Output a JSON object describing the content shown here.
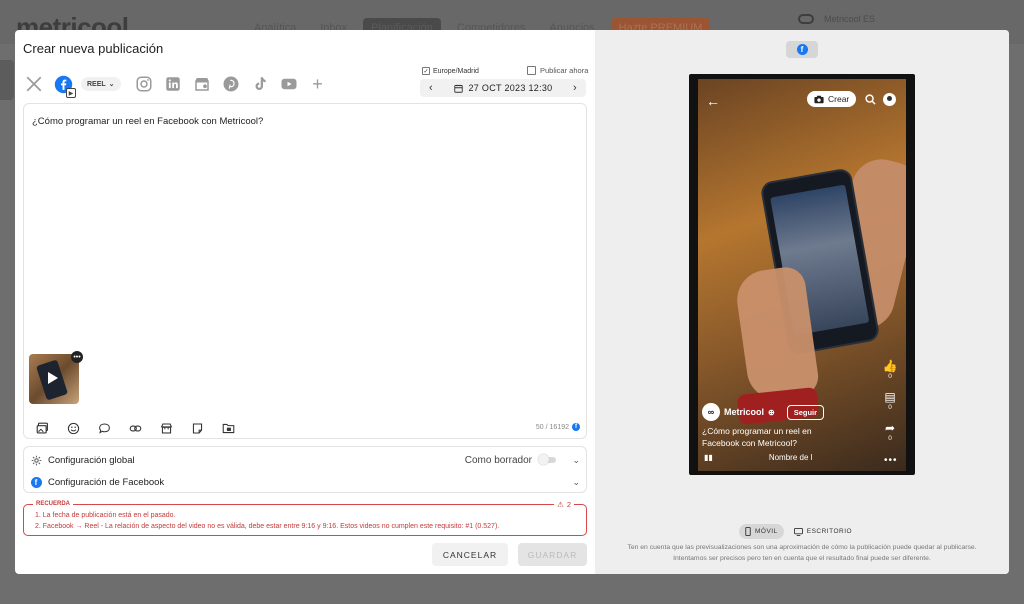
{
  "background": {
    "logo": "metricool",
    "nav": [
      "Analítica",
      "Inbox",
      "Planificación",
      "Competidores",
      "Anuncios"
    ],
    "nav_active": "Planificación",
    "premium": "Hazte PREMIUM",
    "account": "Metricool ES"
  },
  "modal": {
    "title": "Crear nueva publicación",
    "networks": [
      "twitter-x",
      "facebook",
      "instagram",
      "linkedin",
      "google-business",
      "pinterest",
      "tiktok",
      "youtube"
    ],
    "reel_select": "REEL",
    "timezone": "Europe/Madrid",
    "publish_now": "Publicar ahora",
    "date": "27 OCT 2023 12:30",
    "editor_text": "¿Cómo programar un reel en Facebook con Metricool?",
    "counter": "50 / 16192",
    "config_global": "Configuración global",
    "draft_label": "Como borrador",
    "config_facebook": "Configuración de Facebook",
    "warning_title": "RECUERDA",
    "warning_count": "2",
    "warnings": [
      "1. La fecha de publicación está en el pasado.",
      "2. Facebook → Reel - La relación de aspecto del video no es válida, debe estar entre 9:16 y 9:16. Estos videos no cumplen este requisito: #1 (0.527)."
    ],
    "cancel_label": "CANCELAR",
    "save_label": "GUARDAR"
  },
  "preview": {
    "crear_label": "Crear",
    "likes": "0",
    "comments": "0",
    "shares": "0",
    "profile_name": "Metricool",
    "follow_label": "Seguir",
    "caption": "¿Cómo programar un reel en Facebook con Metricool?",
    "audio_label": "Nombre de l",
    "mobile_label": "MÓVIL",
    "desktop_label": "ESCRITORIO",
    "note_line1": "Ten en cuenta que las previsualizaciones son una aproximación de cómo la publicación puede quedar al publicarse.",
    "note_line2": "Intentamos ser precisos pero ten en cuenta que el resultado final puede ser diferente."
  },
  "colors": {
    "facebook": "#1877f2",
    "warning": "#c43a3a"
  }
}
